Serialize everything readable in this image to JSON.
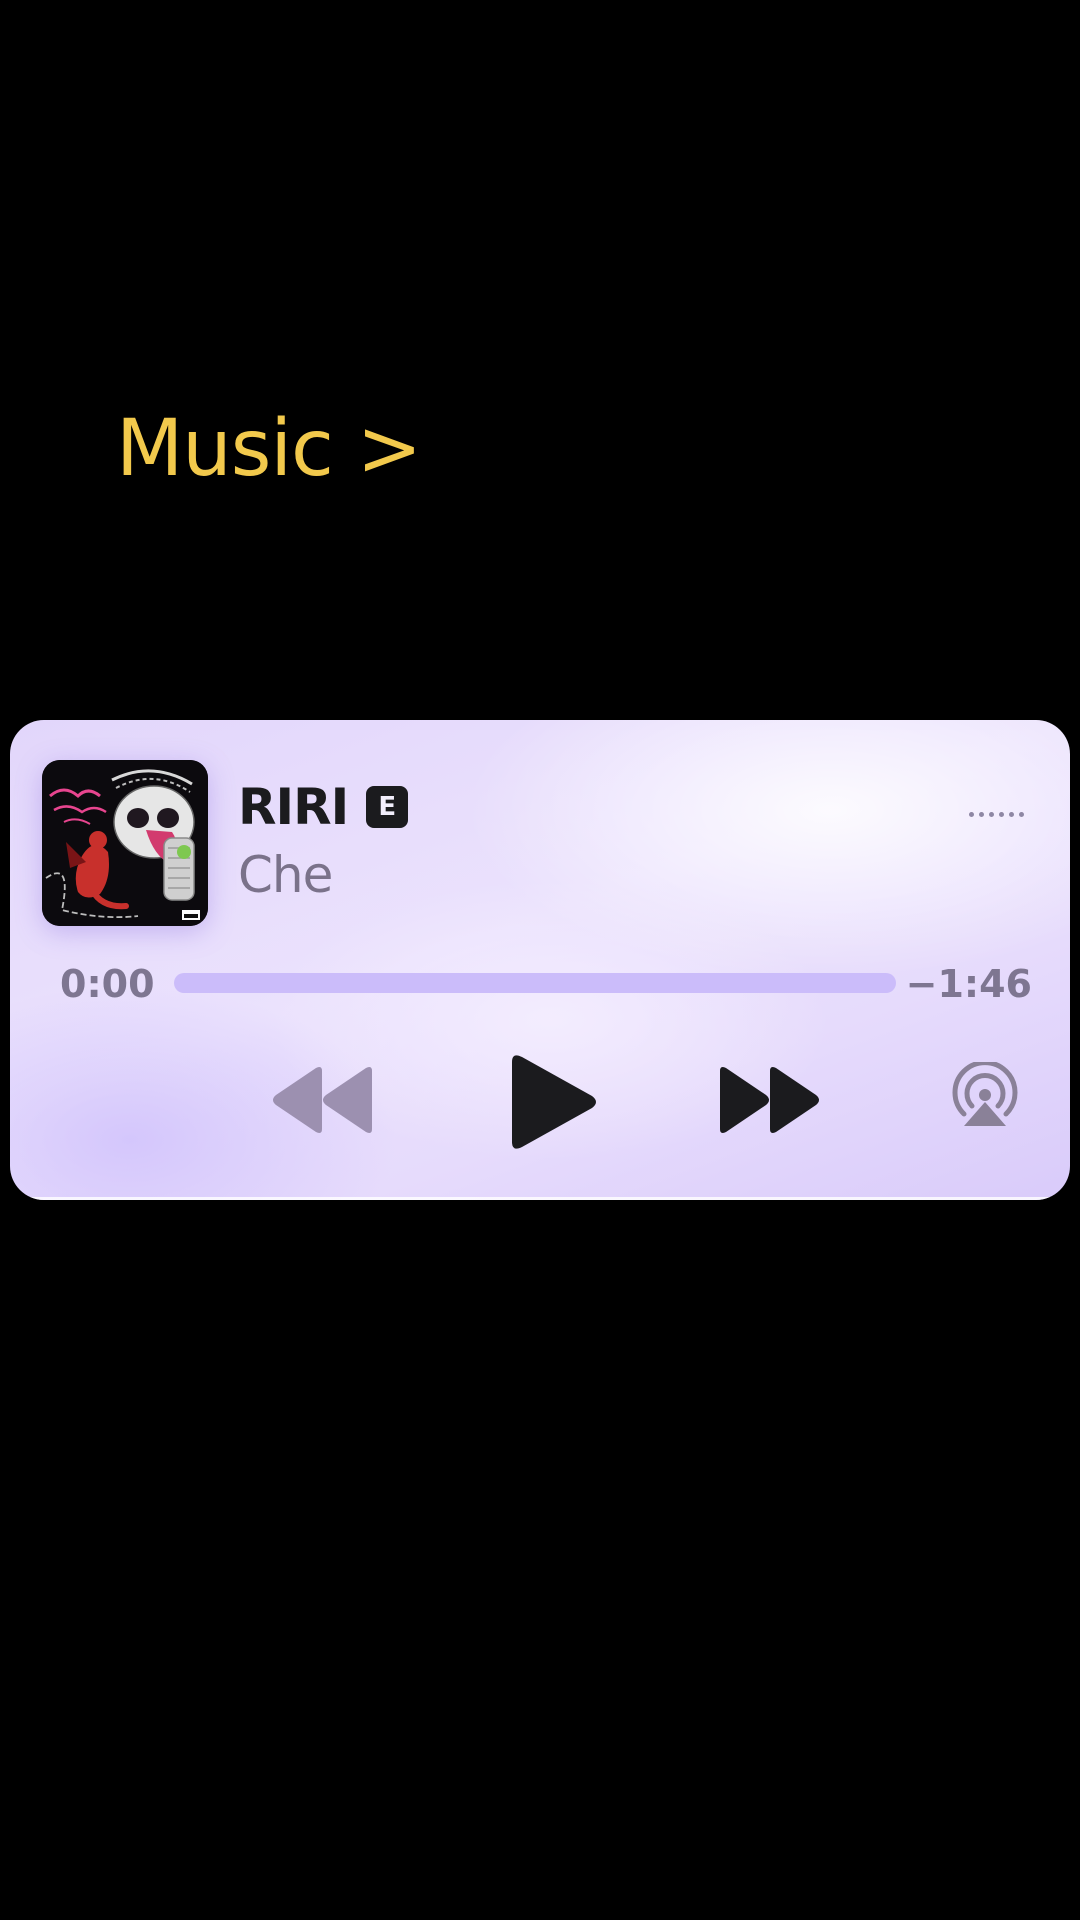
{
  "header": {
    "link_label": "Music >"
  },
  "now_playing": {
    "title": "RIRI",
    "explicit_badge": "E",
    "artist": "Che",
    "time_elapsed": "0:00",
    "time_remaining": "−1:46",
    "progress_fraction": 0.0
  },
  "icons": {
    "more": "more-dots-icon",
    "rewind": "rewind-icon",
    "play": "play-icon",
    "forward": "fast-forward-icon",
    "airplay": "airplay-icon"
  },
  "colors": {
    "header_accent": "#f2c94c",
    "progress_track": "#cbbcfa",
    "control_active": "#1b1b1e",
    "control_disabled": "#9c90b0"
  }
}
